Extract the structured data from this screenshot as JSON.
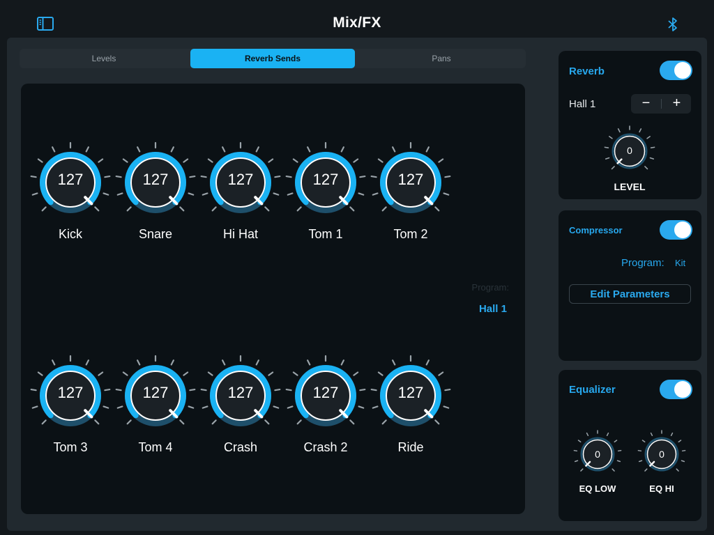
{
  "header": {
    "title": "Mix/FX"
  },
  "tabs": [
    {
      "label": "Levels",
      "active": false
    },
    {
      "label": "Reverb Sends",
      "active": true
    },
    {
      "label": "Pans",
      "active": false
    }
  ],
  "knobs": [
    {
      "label": "Kick",
      "value": "127"
    },
    {
      "label": "Snare",
      "value": "127"
    },
    {
      "label": "Hi Hat",
      "value": "127"
    },
    {
      "label": "Tom 1",
      "value": "127"
    },
    {
      "label": "Tom 2",
      "value": "127"
    },
    {
      "label": "Tom 3",
      "value": "127"
    },
    {
      "label": "Tom 4",
      "value": "127"
    },
    {
      "label": "Crash",
      "value": "127"
    },
    {
      "label": "Crash 2",
      "value": "127"
    },
    {
      "label": "Ride",
      "value": "127"
    }
  ],
  "knob_range": {
    "min": 0,
    "max": 127
  },
  "program_display": {
    "caption": "Program:",
    "value": "Hall 1"
  },
  "reverb": {
    "title": "Reverb",
    "enabled": true,
    "program": "Hall 1",
    "decrement": "−",
    "increment": "+",
    "level_value": "0",
    "level_label": "LEVEL"
  },
  "compressor": {
    "title": "Compressor",
    "enabled": true,
    "program_label": "Program:",
    "program_value": "Kit",
    "edit_button": "Edit Parameters"
  },
  "equalizer": {
    "title": "Equalizer",
    "enabled": true,
    "low_value": "0",
    "low_label": "EQ LOW",
    "hi_value": "0",
    "hi_label": "EQ HI"
  },
  "icons": {
    "sidebar": "sidebar-toggle-icon",
    "bluetooth": "bluetooth-icon"
  },
  "colors": {
    "accent": "#1ab2f3",
    "accent_text": "#27a8ee",
    "panel": "#0b1115",
    "background": "#21292f"
  }
}
